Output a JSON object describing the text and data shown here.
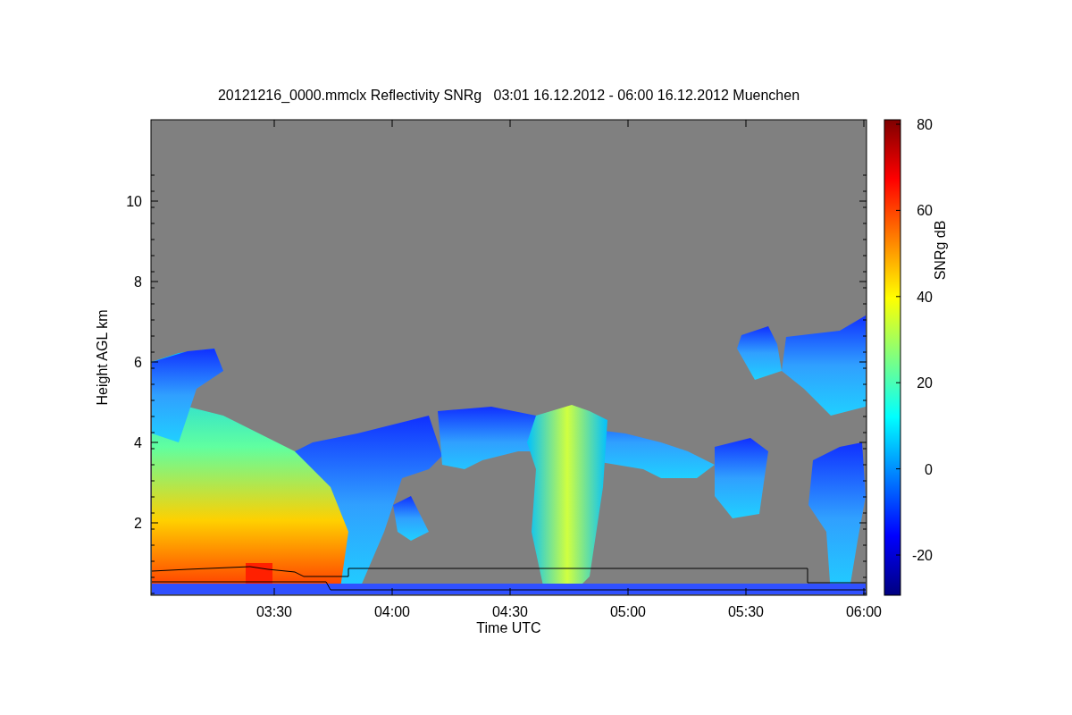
{
  "figure": {
    "title": "20121216_0000.mmclx Reflectivity SNRg   03:01 16.12.2012 - 06:00 16.12.2012 Muenchen",
    "xlabel": "Time UTC",
    "ylabel": "Height AGL km",
    "xticks": [
      "03:30",
      "04:00",
      "04:30",
      "05:00",
      "05:30",
      "06:00"
    ],
    "yticks": [
      "10",
      "8",
      "6",
      "4",
      "2"
    ]
  },
  "colorbar": {
    "label": "SNRg dB",
    "ticks": [
      "80",
      "60",
      "40",
      "20",
      "0",
      "-20"
    ]
  }
}
